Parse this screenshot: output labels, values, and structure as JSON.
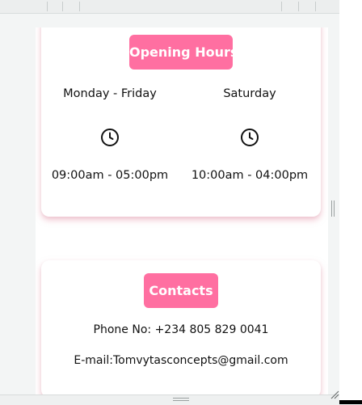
{
  "opening_hours": {
    "title": "Opening Hours",
    "columns": [
      {
        "day": "Monday - Friday",
        "icon": "clock-icon",
        "time": "09:00am - 05:00pm"
      },
      {
        "day": "Saturday",
        "icon": "clock-icon",
        "time": "10:00am - 04:00pm"
      }
    ]
  },
  "contacts": {
    "title": "Contacts",
    "phone": "Phone No: +234 805 829 0041",
    "email": "E-mail:Tomvytasconcepts@gmail.com"
  },
  "colors": {
    "accent": "#ff6fa1",
    "card_shadow": "#e696aa"
  }
}
